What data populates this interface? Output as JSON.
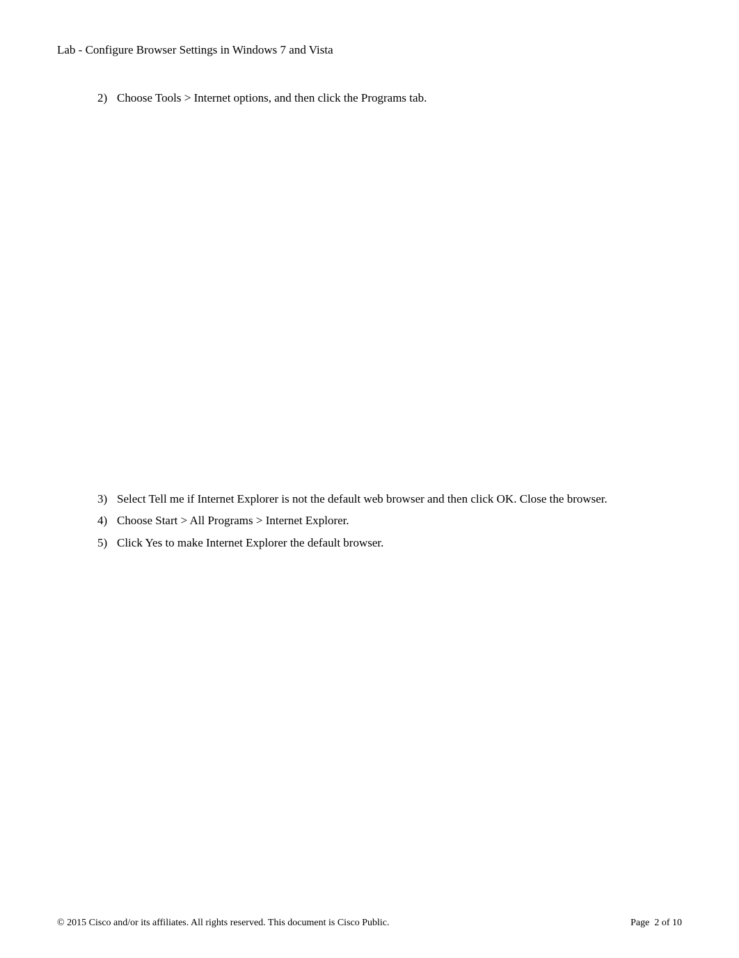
{
  "header": {
    "title": "Lab - Configure Browser Settings in Windows 7 and Vista"
  },
  "steps": {
    "s2": {
      "num": "2)",
      "pre": "Choose   ",
      "bold1": "Tools > Internet options",
      "mid1": ", and then click the   ",
      "bold2": "Programs",
      "post": "   tab."
    },
    "s3": {
      "num": "3)",
      "pre": "Select   ",
      "bold1": "Tell me if Internet Explorer is not the default web browser",
      "mid1": "   and then click   ",
      "bold2": "OK",
      "post": ". Close the browser."
    },
    "s4": {
      "num": "4)",
      "pre": "Choose   ",
      "bold1": "Start > All Programs > Internet Explorer",
      "post": "."
    },
    "s5": {
      "num": "5)",
      "pre": "Click ",
      "bold1": "Yes",
      "post": " to make Internet Explorer the default browser."
    }
  },
  "footer": {
    "copyright": "© 2015 Cisco and/or its affiliates. All rights reserved. This document is Cisco Public.",
    "page_label": "Page  ",
    "page_current": "2",
    "page_of": " of ",
    "page_total": "10"
  }
}
